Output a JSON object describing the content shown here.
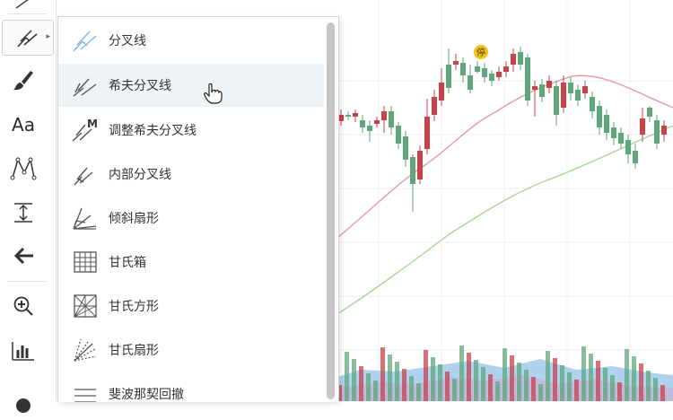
{
  "toolbar": {
    "icons": [
      "pitchfork-tool-icon",
      "brush-icon",
      "text-tool-icon",
      "pattern-tool-icon",
      "measure-icon",
      "back-arrow-icon",
      "zoom-in-icon",
      "ruler-icon"
    ],
    "text_tool_label": "Aa"
  },
  "chart": {
    "halt_badge": "停",
    "colors": {
      "up": "#c9424a",
      "down": "#5da87a",
      "ma_short": "#e89aa3",
      "ma_long": "#a8d59b",
      "vol_bg": "#9ec7ea",
      "vol_bg2": "#c4b3d9"
    }
  },
  "menu": {
    "items": [
      {
        "label": "分叉线",
        "icon": "pitchfork-icon"
      },
      {
        "label": "希夫分叉线",
        "icon": "schiff-pitchfork-icon"
      },
      {
        "label": "调整希夫分叉线",
        "icon": "modified-schiff-pitchfork-icon"
      },
      {
        "label": "内部分叉线",
        "icon": "inside-pitchfork-icon"
      },
      {
        "label": "倾斜扇形",
        "icon": "pitchfan-icon"
      },
      {
        "label": "甘氏箱",
        "icon": "gann-box-icon"
      },
      {
        "label": "甘氏方形",
        "icon": "gann-square-icon"
      },
      {
        "label": "甘氏扇形",
        "icon": "gann-fan-icon"
      },
      {
        "label": "斐波那契回撤",
        "icon": "fib-retracement-icon"
      }
    ],
    "hovered_index": 1
  }
}
